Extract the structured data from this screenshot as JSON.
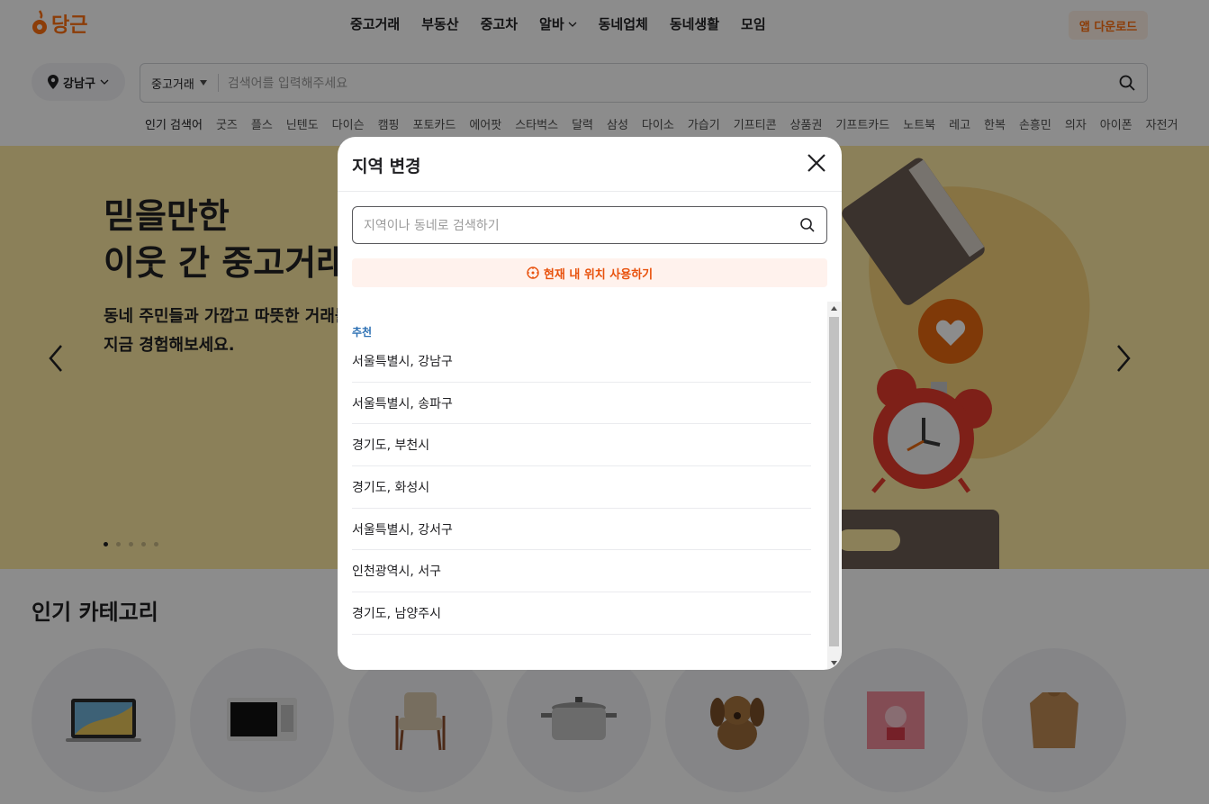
{
  "header": {
    "logo_text": "당근",
    "nav": [
      "중고거래",
      "부동산",
      "중고차",
      "알바",
      "동네업체",
      "동네생활",
      "모임"
    ],
    "app_download": "앱 다운로드"
  },
  "search": {
    "location": "강남구",
    "category": "중고거래",
    "placeholder": "검색어를 입력해주세요"
  },
  "popular": {
    "label": "인기 검색어",
    "items": [
      "굿즈",
      "플스",
      "닌텐도",
      "다이슨",
      "캠핑",
      "포토카드",
      "에어팟",
      "스타벅스",
      "달력",
      "삼성",
      "다이소",
      "가습기",
      "기프티콘",
      "상품권",
      "기프트카드",
      "노트북",
      "레고",
      "한복",
      "손흥민",
      "의자",
      "아이폰",
      "자전거"
    ]
  },
  "banner": {
    "title_line1": "믿을만한",
    "title_line2": "이웃 간 중고거래",
    "sub_line1": "동네 주민들과 가깝고 따뜻한 거래를",
    "sub_line2": "지금 경험해보세요.",
    "slide_count": 5,
    "active_slide": 1
  },
  "categories": {
    "title": "인기 카테고리"
  },
  "modal": {
    "title": "지역 변경",
    "search_placeholder": "지역이나 동네로 검색하기",
    "use_location": "현재 내 위치 사용하기",
    "recommend_label": "추천",
    "regions": [
      "서울특별시, 강남구",
      "서울특별시, 송파구",
      "경기도, 부천시",
      "경기도, 화성시",
      "서울특별시, 강서구",
      "인천광역시, 서구",
      "경기도, 남양주시"
    ]
  },
  "colors": {
    "brand": "#ff6f0f",
    "banner_bg": "#fde9a3",
    "recommend": "#2b6fb3"
  }
}
